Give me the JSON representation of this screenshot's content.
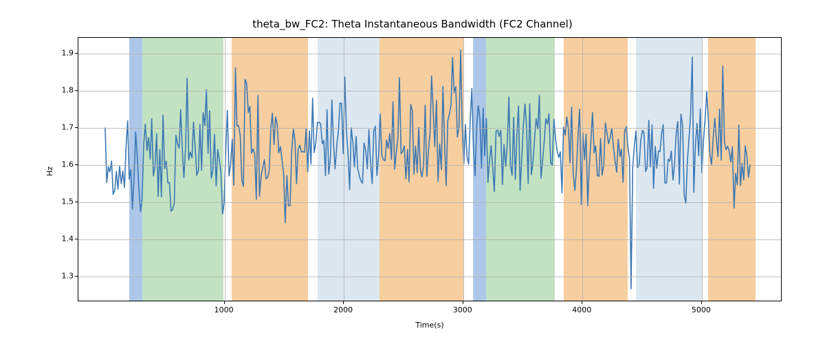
{
  "chart_data": {
    "type": "line",
    "title": "theta_bw_FC2: Theta Instantaneous Bandwidth (FC2 Channel)",
    "xlabel": "Time(s)",
    "ylabel": "Hz",
    "xlim": [
      -225,
      5675
    ],
    "ylim": [
      1.232,
      1.942
    ],
    "x_ticks": [
      1000,
      2000,
      3000,
      4000,
      5000
    ],
    "y_ticks": [
      1.3,
      1.4,
      1.5,
      1.6,
      1.7,
      1.8,
      1.9
    ],
    "y_tick_labels": [
      "1.3",
      "1.4",
      "1.5",
      "1.6",
      "1.7",
      "1.8",
      "1.9"
    ],
    "bands": [
      {
        "start": 200,
        "end": 310,
        "color": "#aec7e8"
      },
      {
        "start": 310,
        "end": 990,
        "color": "#c3e2c3"
      },
      {
        "start": 1060,
        "end": 1700,
        "color": "#f6ce9f"
      },
      {
        "start": 1780,
        "end": 2300,
        "color": "#dde7f0"
      },
      {
        "start": 2300,
        "end": 3000,
        "color": "#f6ce9f"
      },
      {
        "start": 3080,
        "end": 3190,
        "color": "#aec7e8"
      },
      {
        "start": 3190,
        "end": 3770,
        "color": "#c3e2c3"
      },
      {
        "start": 3840,
        "end": 4380,
        "color": "#f6ce9f"
      },
      {
        "start": 4450,
        "end": 5000,
        "color": "#dde7f0"
      },
      {
        "start": 5050,
        "end": 5450,
        "color": "#f6ce9f"
      }
    ],
    "series": [
      {
        "name": "theta_bw_FC2",
        "color": "#3a77b4",
        "x": [
          0,
          13,
          27,
          40,
          54,
          67,
          81,
          94,
          108,
          121,
          135,
          148,
          162,
          175,
          189,
          202,
          216,
          229,
          243,
          256,
          270,
          283,
          297,
          310,
          324,
          337,
          351,
          364,
          378,
          391,
          405,
          418,
          432,
          445,
          459,
          472,
          486,
          499,
          513,
          526,
          540,
          553,
          567,
          580,
          594,
          607,
          621,
          634,
          648,
          661,
          675,
          688,
          702,
          715,
          729,
          742,
          756,
          769,
          783,
          796,
          810,
          823,
          837,
          850,
          864,
          877,
          891,
          904,
          918,
          932,
          945,
          959,
          972,
          986,
          999,
          1013,
          1026,
          1040,
          1053,
          1067,
          1080,
          1094,
          1107,
          1121,
          1134,
          1148,
          1161,
          1175,
          1188,
          1202,
          1215,
          1229,
          1242,
          1256,
          1269,
          1283,
          1296,
          1310,
          1323,
          1337,
          1350,
          1364,
          1377,
          1391,
          1404,
          1418,
          1431,
          1445,
          1458,
          1472,
          1485,
          1499,
          1512,
          1526,
          1539,
          1553,
          1566,
          1580,
          1593,
          1607,
          1620,
          1634,
          1647,
          1661,
          1674,
          1688,
          1701,
          1715,
          1728,
          1742,
          1755,
          1769,
          1782,
          1796,
          1809,
          1823,
          1836,
          1850,
          1863,
          1877,
          1891,
          1904,
          1918,
          1931,
          1945,
          1958,
          1972,
          1985,
          1999,
          2012,
          2026,
          2039,
          2053,
          2066,
          2080,
          2093,
          2107,
          2120,
          2134,
          2147,
          2161,
          2174,
          2188,
          2201,
          2215,
          2228,
          2242,
          2255,
          2269,
          2282,
          2296,
          2309,
          2323,
          2336,
          2350,
          2363,
          2377,
          2390,
          2404,
          2417,
          2431,
          2444,
          2458,
          2471,
          2485,
          2498,
          2512,
          2525,
          2539,
          2552,
          2566,
          2579,
          2593,
          2606,
          2620,
          2633,
          2647,
          2660,
          2674,
          2687,
          2701,
          2714,
          2728,
          2741,
          2755,
          2768,
          2782,
          2795,
          2809,
          2823,
          2836,
          2850,
          2863,
          2877,
          2890,
          2904,
          2917,
          2931,
          2944,
          2958,
          2971,
          2985,
          2998,
          3012,
          3025,
          3039,
          3052,
          3066,
          3079,
          3093,
          3106,
          3120,
          3133,
          3147,
          3160,
          3174,
          3187,
          3201,
          3214,
          3228,
          3241,
          3255,
          3268,
          3282,
          3295,
          3309,
          3322,
          3336,
          3349,
          3363,
          3376,
          3390,
          3403,
          3417,
          3430,
          3444,
          3457,
          3471,
          3484,
          3498,
          3511,
          3525,
          3538,
          3552,
          3565,
          3579,
          3592,
          3606,
          3619,
          3633,
          3646,
          3660,
          3673,
          3687,
          3700,
          3714,
          3727,
          3741,
          3754,
          3768,
          3782,
          3795,
          3809,
          3822,
          3836,
          3849,
          3863,
          3876,
          3890,
          3903,
          3917,
          3930,
          3944,
          3957,
          3971,
          3984,
          3998,
          4011,
          4025,
          4038,
          4052,
          4065,
          4079,
          4092,
          4106,
          4119,
          4133,
          4146,
          4160,
          4173,
          4187,
          4200,
          4214,
          4227,
          4241,
          4254,
          4268,
          4281,
          4295,
          4308,
          4322,
          4335,
          4349,
          4362,
          4376,
          4389,
          4403,
          4416,
          4430,
          4443,
          4457,
          4470,
          4484,
          4497,
          4511,
          4524,
          4538,
          4551,
          4565,
          4578,
          4592,
          4605,
          4619,
          4632,
          4646,
          4659,
          4673,
          4686,
          4700,
          4714,
          4727,
          4741,
          4754,
          4768,
          4781,
          4795,
          4808,
          4822,
          4835,
          4849,
          4862,
          4876,
          4889,
          4903,
          4916,
          4930,
          4943,
          4957,
          4970,
          4984,
          4997,
          5011,
          5024,
          5038,
          5051,
          5065,
          5078,
          5092,
          5105,
          5119,
          5132,
          5146,
          5159,
          5173,
          5186,
          5200,
          5213,
          5227,
          5240,
          5254,
          5267,
          5281,
          5294,
          5308,
          5321,
          5335,
          5348,
          5362,
          5375,
          5389,
          5402,
          5416,
          5429,
          5443,
          5450
        ],
        "y": [
          1.7,
          1.551,
          1.594,
          1.58,
          1.609,
          1.519,
          1.531,
          1.581,
          1.533,
          1.595,
          1.548,
          1.582,
          1.538,
          1.645,
          1.718,
          1.56,
          1.586,
          1.479,
          1.569,
          1.688,
          1.619,
          1.537,
          1.472,
          1.506,
          1.656,
          1.709,
          1.637,
          1.673,
          1.614,
          1.724,
          1.569,
          1.594,
          1.683,
          1.514,
          1.64,
          1.512,
          1.733,
          1.589,
          1.609,
          1.55,
          1.551,
          1.474,
          1.479,
          1.494,
          1.679,
          1.657,
          1.644,
          1.748,
          1.638,
          1.564,
          1.645,
          1.833,
          1.612,
          1.633,
          1.618,
          1.714,
          1.645,
          1.571,
          1.584,
          1.708,
          1.584,
          1.74,
          1.705,
          1.802,
          1.63,
          1.745,
          1.563,
          1.583,
          1.681,
          1.542,
          1.64,
          1.612,
          1.578,
          1.466,
          1.497,
          1.644,
          1.746,
          1.569,
          1.599,
          1.668,
          1.544,
          1.861,
          1.704,
          1.705,
          1.678,
          1.556,
          1.541,
          1.83,
          1.819,
          1.74,
          1.757,
          1.63,
          1.642,
          1.629,
          1.506,
          1.786,
          1.514,
          1.57,
          1.591,
          1.613,
          1.561,
          1.565,
          1.582,
          1.698,
          1.738,
          1.654,
          1.728,
          1.707,
          1.631,
          1.648,
          1.612,
          1.574,
          1.443,
          1.57,
          1.488,
          1.489,
          1.633,
          1.695,
          1.667,
          1.548,
          1.64,
          1.652,
          1.634,
          1.635,
          1.633,
          1.696,
          1.58,
          1.691,
          1.601,
          1.779,
          1.632,
          1.658,
          1.714,
          1.714,
          1.71,
          1.656,
          1.665,
          1.57,
          1.748,
          1.574,
          1.615,
          1.774,
          1.652,
          1.588,
          1.653,
          1.687,
          1.766,
          1.765,
          1.629,
          1.836,
          1.692,
          1.631,
          1.532,
          1.699,
          1.659,
          1.593,
          1.676,
          1.59,
          1.57,
          1.556,
          1.549,
          1.658,
          1.638,
          1.588,
          1.694,
          1.605,
          1.548,
          1.691,
          1.703,
          1.57,
          1.624,
          1.736,
          1.624,
          1.613,
          1.61,
          1.666,
          1.643,
          1.683,
          1.613,
          1.769,
          1.587,
          1.63,
          1.672,
          1.834,
          1.629,
          1.635,
          1.65,
          1.561,
          1.64,
          1.553,
          1.762,
          1.746,
          1.574,
          1.65,
          1.578,
          1.7,
          1.586,
          1.566,
          1.599,
          1.76,
          1.568,
          1.636,
          1.686,
          1.839,
          1.742,
          1.648,
          1.773,
          1.554,
          1.655,
          1.586,
          1.811,
          1.658,
          1.543,
          1.719,
          1.735,
          1.76,
          1.889,
          1.794,
          1.81,
          1.674,
          1.701,
          1.909,
          1.705,
          1.602,
          1.708,
          1.619,
          1.601,
          1.726,
          1.805,
          1.636,
          1.569,
          1.706,
          1.759,
          1.725,
          1.59,
          1.752,
          1.623,
          1.724,
          1.551,
          1.613,
          1.651,
          1.589,
          1.527,
          1.69,
          1.693,
          1.676,
          1.692,
          1.546,
          1.654,
          1.595,
          1.653,
          1.782,
          1.6,
          1.571,
          1.727,
          1.56,
          1.675,
          1.758,
          1.53,
          1.615,
          1.702,
          1.763,
          1.706,
          1.549,
          1.764,
          1.572,
          1.606,
          1.672,
          1.724,
          1.696,
          1.786,
          1.563,
          1.611,
          1.663,
          1.724,
          1.709,
          1.737,
          1.604,
          1.598,
          1.722,
          1.669,
          1.637,
          1.619,
          1.634,
          1.523,
          1.701,
          1.679,
          1.728,
          1.697,
          1.604,
          1.755,
          1.576,
          1.53,
          1.584,
          1.679,
          1.749,
          1.492,
          1.685,
          1.613,
          1.682,
          1.489,
          1.595,
          1.665,
          1.74,
          1.631,
          1.65,
          1.57,
          1.568,
          1.67,
          1.571,
          1.599,
          1.712,
          1.684,
          1.656,
          1.673,
          1.697,
          1.648,
          1.611,
          1.579,
          1.668,
          1.621,
          1.641,
          1.552,
          1.69,
          1.702,
          1.648,
          1.616,
          1.264,
          1.593,
          1.647,
          1.69,
          1.592,
          1.598,
          1.663,
          1.692,
          1.687,
          1.581,
          1.591,
          1.719,
          1.593,
          1.707,
          1.536,
          1.649,
          1.59,
          1.636,
          1.635,
          1.684,
          1.707,
          1.55,
          1.55,
          1.614,
          1.609,
          1.636,
          1.558,
          1.601,
          1.685,
          1.716,
          1.547,
          1.736,
          1.705,
          1.517,
          1.495,
          1.609,
          1.672,
          1.737,
          1.89,
          1.525,
          1.657,
          1.711,
          1.623,
          1.75,
          1.578,
          1.665,
          1.723,
          1.798,
          1.721,
          1.626,
          1.6,
          1.67,
          1.725,
          1.669,
          1.621,
          1.749,
          1.612,
          1.866,
          1.661,
          1.64,
          1.649,
          1.636,
          1.607,
          1.648,
          1.482,
          1.576,
          1.545,
          1.706,
          1.543,
          1.603,
          1.558,
          1.65,
          1.62,
          1.566,
          1.6
        ]
      }
    ]
  }
}
